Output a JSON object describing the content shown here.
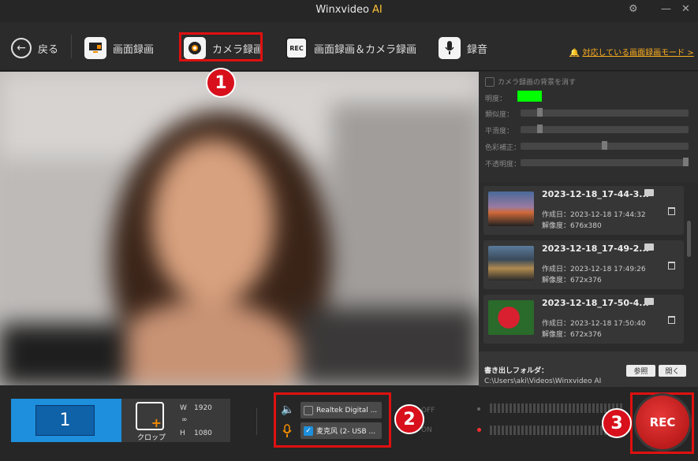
{
  "app": {
    "title": "Winxvideo",
    "title_suffix": "AI"
  },
  "toolbar": {
    "back_label": "戻る",
    "screen_rec_label": "画面録画",
    "camera_rec_label": "カメラ録画",
    "screen_camera_label": "画面録画＆カメラ録画",
    "audio_label": "録音",
    "rec_icon_text": "REC",
    "notice_link": "対応している画面録画モード >"
  },
  "settings": {
    "bg_remove_label": "カメラ録画の背景を消す",
    "brightness_label": "明度：",
    "similarity_label": "類似度：",
    "smoothness_label": "平滑度：",
    "color_correction_label": "色彩補正：",
    "transparency_label": "不透明度：",
    "key_color": "#00ff00"
  },
  "files": [
    {
      "name": "2023-12-18_17-44-3...",
      "created": "作成日：2023-12-18 17:44:32",
      "resolution": "解像度：676x380"
    },
    {
      "name": "2023-12-18_17-49-2...",
      "created": "作成日：2023-12-18 17:49:26",
      "resolution": "解像度：672x376"
    },
    {
      "name": "2023-12-18_17-50-4...",
      "created": "作成日：2023-12-18 17:50:40",
      "resolution": "解像度：672x376"
    }
  ],
  "export": {
    "label": "書き出しフォルダ：",
    "path": "C:\\Users\\aki\\Videos\\Winxvideo AI",
    "browse_label": "参照",
    "open_label": "開く"
  },
  "bottom": {
    "screen_number": "1",
    "crop_label": "クロップ",
    "w_label": "W",
    "w_value": "1920",
    "h_label": "H",
    "h_value": "1080",
    "speaker_device": "Realtek Digital ...",
    "mic_device": "麦克风 (2- USB ...",
    "off_label": "OFF",
    "on_label": "ON",
    "rec_label": "REC"
  },
  "badges": {
    "one": "1",
    "two": "2",
    "three": "3"
  }
}
